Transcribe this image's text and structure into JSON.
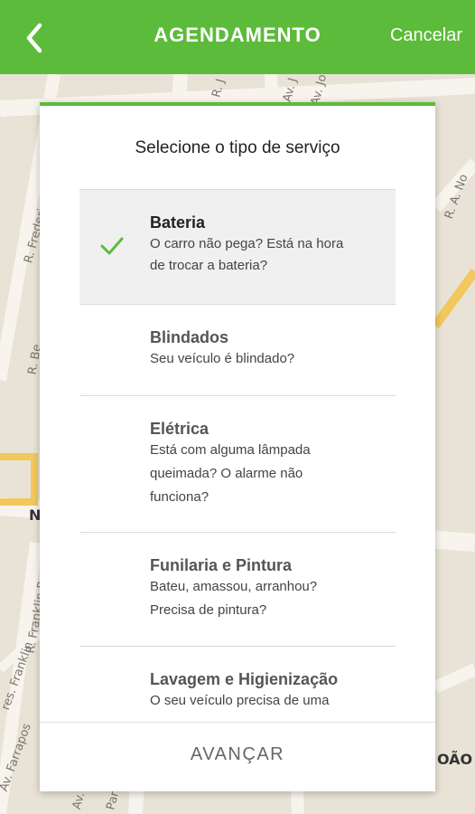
{
  "header": {
    "title": "AGENDAMENTO",
    "cancel_label": "Cancelar",
    "back_icon": "chevron-left-icon"
  },
  "colors": {
    "accent": "#5dbb3b",
    "map_bg": "#e8e3d6",
    "road": "#f7f4ee",
    "highlight_road": "#f2c75c"
  },
  "map": {
    "labels": {
      "r_frederico": "R. Frederic",
      "r_be": "R. Be",
      "ave_j": "R. J",
      "av_j2": "Av. J",
      "av_jo": "Av. Jo",
      "r_a_no": "R. A. No",
      "n_label": "N",
      "franklin": "R. Franklin Roose",
      "pres_franklin": "res. Franklin",
      "farrapos": "Av. Farrapos",
      "av_short": "Av.",
      "para": "Para",
      "oao": "OÃO"
    }
  },
  "dialog": {
    "title": "Selecione o tipo de serviço",
    "check_icon": "checkmark-icon",
    "items": [
      {
        "name": "Bateria",
        "desc": [
          "O carro não pega? Está na hora",
          "de trocar a bateria?"
        ],
        "selected": true
      },
      {
        "name": "Blindados",
        "desc": [
          "Seu veículo é blindado?"
        ],
        "selected": false
      },
      {
        "name": "Elétrica",
        "desc": [
          "Está com alguma lâmpada",
          "queimada? O alarme não",
          "funciona?"
        ],
        "selected": false
      },
      {
        "name": "Funilaria e Pintura",
        "desc": [
          "Bateu, amassou, arranhou?",
          "Precisa de pintura?"
        ],
        "selected": false
      },
      {
        "name": "Lavagem e Higienização",
        "desc": [
          "O seu veículo precisa de uma"
        ],
        "selected": false
      }
    ],
    "footer_button": "AVANÇAR"
  }
}
